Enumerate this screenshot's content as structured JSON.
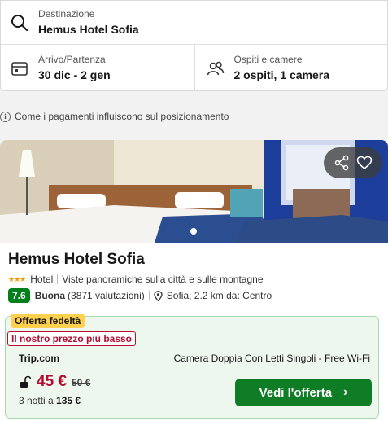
{
  "search": {
    "destination_label": "Destinazione",
    "destination_value": "Hemus Hotel Sofia",
    "dates_label": "Arrivo/Partenza",
    "dates_value": "30 dic - 2 gen",
    "guests_label": "Ospiti e camere",
    "guests_value": "2 ospiti, 1 camera"
  },
  "info": {
    "text": "Come i pagamenti influiscono sul posizionamento",
    "icon": "i"
  },
  "hotel": {
    "name": "Hemus Hotel Sofia",
    "stars": "★★★",
    "type": "Hotel",
    "tagline": "Viste panoramiche sulla città e sulle montagne",
    "rating": "7.6",
    "rating_word": "Buona",
    "reviews": "(3871 valutazioni)",
    "location": "Sofia, 2.2 km da: Centro"
  },
  "offer": {
    "loyalty_tag": "Offerta fedeltà",
    "price_tag": "Il nostro prezzo più basso",
    "provider": "Trip.com",
    "room_type": "Camera Doppia Con Letti Singoli - Free Wi-Fi",
    "price": "45 €",
    "old_price": "50 €",
    "total_prefix": "3 notti a",
    "total_price": "135 €",
    "cta_label": "Vedi l'offerta",
    "cta_chevron": "›"
  },
  "colors": {
    "rating_green": "#007f1c",
    "cta_green": "#0e7d25",
    "price_red": "#b30e31",
    "loyalty_yellow": "#ffd14d",
    "star_orange": "#f29b0a"
  }
}
